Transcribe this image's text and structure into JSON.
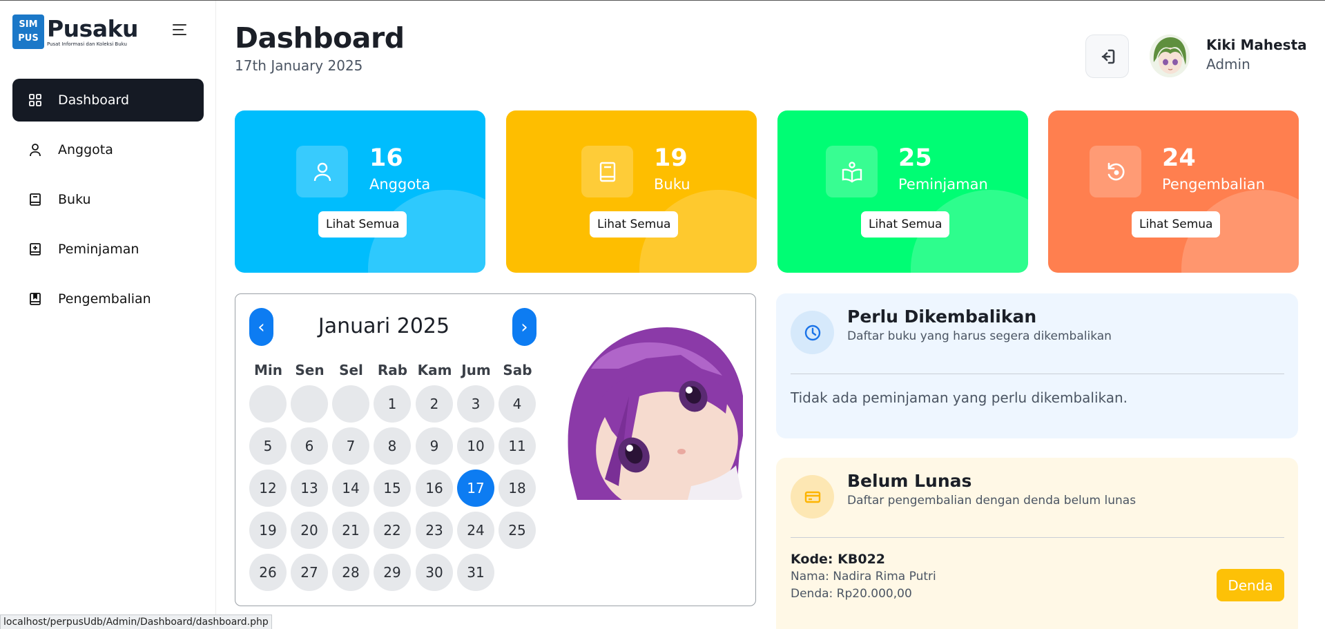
{
  "brand": {
    "logo_text": "SIM PUS",
    "name": "Pusaku",
    "tagline": "Pusat Informasi dan Koleksi Buku"
  },
  "sidebar": {
    "items": [
      {
        "label": "Dashboard",
        "icon": "grid-icon",
        "active": true
      },
      {
        "label": "Anggota",
        "icon": "user-icon",
        "active": false
      },
      {
        "label": "Buku",
        "icon": "book-icon",
        "active": false
      },
      {
        "label": "Peminjaman",
        "icon": "plus-square-icon",
        "active": false
      },
      {
        "label": "Pengembalian",
        "icon": "book-return-icon",
        "active": false
      }
    ]
  },
  "header": {
    "title": "Dashboard",
    "date": "17th January 2025",
    "user_name": "Kiki Mahesta",
    "user_role": "Admin"
  },
  "stats": [
    {
      "value": "16",
      "label": "Anggota",
      "button": "Lihat Semua",
      "color": "#00bdfd",
      "icon": "user-icon"
    },
    {
      "value": "19",
      "label": "Buku",
      "button": "Lihat Semua",
      "color": "#febe00",
      "icon": "book-icon"
    },
    {
      "value": "25",
      "label": "Peminjaman",
      "button": "Lihat Semua",
      "color": "#00fd74",
      "icon": "open-book-reader-icon"
    },
    {
      "value": "24",
      "label": "Pengembalian",
      "button": "Lihat Semua",
      "color": "#ff7f4f",
      "icon": "rotate-ccw-icon"
    }
  ],
  "calendar": {
    "title": "Januari 2025",
    "weekdays": [
      "Min",
      "Sen",
      "Sel",
      "Rab",
      "Kam",
      "Jum",
      "Sab"
    ],
    "leading_blanks": 3,
    "days_in_month": 31,
    "today": 17,
    "accent": "#0d7cf2"
  },
  "due_panel": {
    "title": "Perlu Dikembalikan",
    "subtitle": "Daftar buku yang harus segera dikembalikan",
    "empty_message": "Tidak ada peminjaman yang perlu dikembalikan."
  },
  "unpaid_panel": {
    "title": "Belum Lunas",
    "subtitle": "Daftar pengembalian dengan denda belum lunas",
    "items": [
      {
        "code": "Kode: KB022",
        "name": "Nama: Nadira Rima Putri",
        "fine": "Denda: Rp20.000,00",
        "button": "Denda"
      }
    ]
  },
  "status_url": "localhost/perpusUdb/Admin/Dashboard/dashboard.php"
}
